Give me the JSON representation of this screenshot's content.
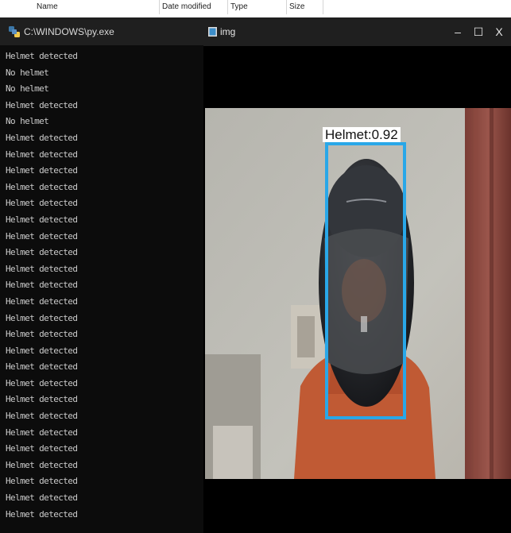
{
  "explorer": {
    "columns": [
      "Name",
      "Date modified",
      "Type",
      "Size"
    ]
  },
  "console": {
    "title": "C:\\WINDOWS\\py.exe",
    "lines": [
      "Helmet detected",
      "No helmet",
      "No helmet",
      "Helmet detected",
      "No helmet",
      "Helmet detected",
      "Helmet detected",
      "Helmet detected",
      "Helmet detected",
      "Helmet detected",
      "Helmet detected",
      "Helmet detected",
      "Helmet detected",
      "Helmet detected",
      "Helmet detected",
      "Helmet detected",
      "Helmet detected",
      "Helmet detected",
      "Helmet detected",
      "Helmet detected",
      "Helmet detected",
      "Helmet detected",
      "Helmet detected",
      "Helmet detected",
      "Helmet detected",
      "Helmet detected",
      "Helmet detected",
      "Helmet detected",
      "Helmet detected"
    ]
  },
  "image_window": {
    "title": "img",
    "minimize": "–",
    "maximize": "☐",
    "close": "X",
    "detection": {
      "label": "Helmet:0.92",
      "box_color": "#29a7e8"
    }
  },
  "colors": {
    "titlebar": "#1f1f1f",
    "console_bg": "#0c0c0c",
    "console_text": "#cccccc"
  }
}
